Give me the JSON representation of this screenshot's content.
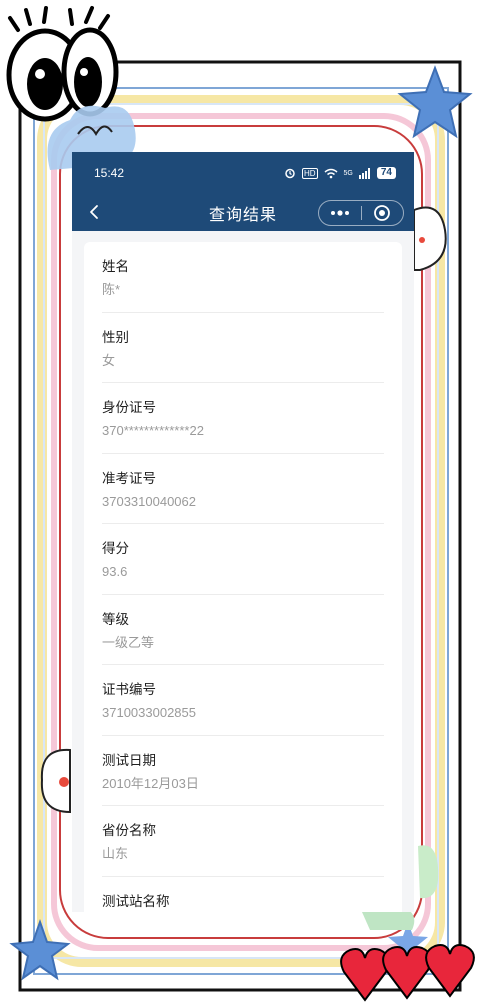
{
  "status_bar": {
    "time": "15:42",
    "hd": "HD",
    "signal": "5G",
    "battery": "74"
  },
  "nav": {
    "title": "查询结果"
  },
  "records": [
    {
      "label": "姓名",
      "value": "陈*"
    },
    {
      "label": "性别",
      "value": "女"
    },
    {
      "label": "身份证号",
      "value": "370*************22"
    },
    {
      "label": "准考证号",
      "value": "3703310040062"
    },
    {
      "label": "得分",
      "value": "93.6"
    },
    {
      "label": "等级",
      "value": "一级乙等"
    },
    {
      "label": "证书编号",
      "value": "3710033002855"
    },
    {
      "label": "测试日期",
      "value": "2010年12月03日"
    },
    {
      "label": "省份名称",
      "value": "山东"
    },
    {
      "label": "测试站名称",
      "value": ""
    }
  ],
  "colors": {
    "header": "#1e4a78",
    "label_text": "#1f1f1f",
    "value_text": "#9a9a9a"
  }
}
